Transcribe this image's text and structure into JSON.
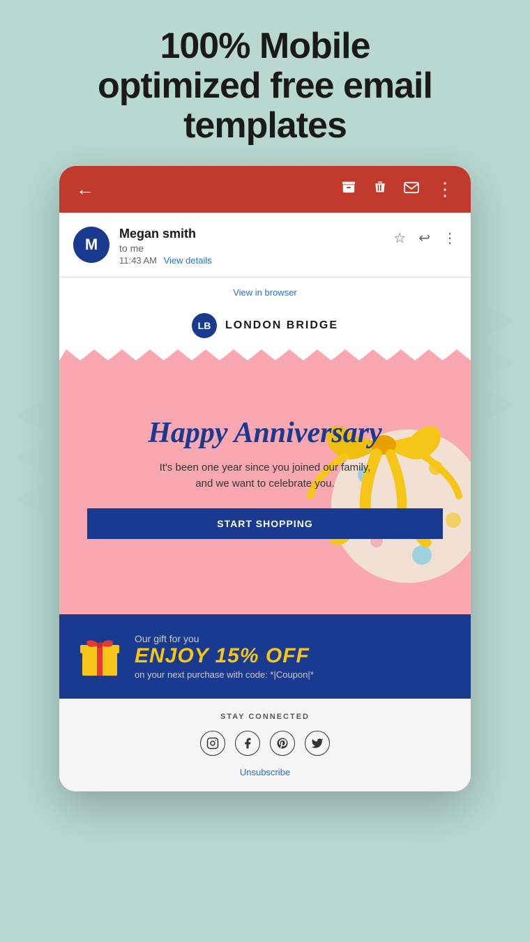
{
  "page": {
    "title_line1": "100% Mobile",
    "title_line2": "optimized free email",
    "title_line3": "templates",
    "background_color": "#b8d8d0"
  },
  "toolbar": {
    "back_icon": "←",
    "archive_icon": "📥",
    "delete_icon": "🗑",
    "email_icon": "✉",
    "more_icon": "⋮",
    "bg_color": "#c0392b"
  },
  "email_header": {
    "avatar_letter": "M",
    "avatar_bg": "#1a3a8f",
    "sender_name": "Megan smith",
    "to_label": "to me",
    "time": "11:43 AM",
    "view_details": "View details",
    "star_icon": "☆",
    "reply_icon": "↩",
    "more_icon": "⋮"
  },
  "email_body": {
    "view_in_browser": "View in browser",
    "brand": {
      "logo_letters": "LB",
      "name": "LONDON BRIDGE"
    },
    "banner": {
      "headline": "Happy Anniversary",
      "subtext_line1": "It's been one year since you joined our family,",
      "subtext_line2": "and we want to celebrate you.",
      "cta_button": "START SHOPPING"
    },
    "gift": {
      "our_gift_label": "Our gift for you",
      "discount": "ENJOY 15% OFF",
      "coupon_text": "on your next purchase with code: *|Coupon|*"
    },
    "footer": {
      "stay_connected": "STAY CONNECTED",
      "social_icons": [
        "instagram",
        "facebook",
        "pinterest",
        "twitter"
      ],
      "unsubscribe": "Unsubscribe"
    }
  }
}
